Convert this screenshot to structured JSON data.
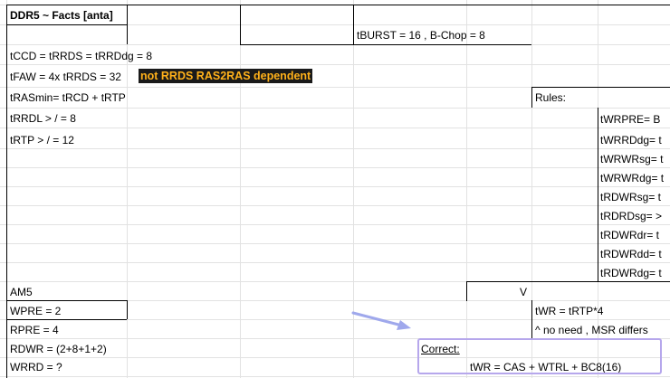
{
  "cells": {
    "title_a": "DDR5 ~ Facts ",
    "title_b": "[anta]",
    "tburst": "tBURST = 16 , B-Chop = 8",
    "tccd": "tCCD = tRRDS = tRRDdg = 8",
    "tfaw": "tFAW = 4x tRRDS = 32",
    "tfaw_note": "not RRDS RAS2RAS dependent",
    "trasmin": "tRASmin= tRCD + tRTP",
    "trrdl": "tRRDL > / = 8",
    "trtp": "tRTP > / = 12",
    "rules": "Rules:",
    "rules_list": [
      "tWRPRE=  B",
      "tWRRDdg= t",
      "tWRWRsg= t",
      "tWRWRdg= t",
      "tRDWRsg= t",
      "tRDRDsg=  >",
      "tRDWRdr=  t",
      "tRDWRdd= t",
      "tRDWRdg= t"
    ],
    "am5": "AM5",
    "v": "V",
    "wpre": "WPRE = 2",
    "twr": "tWR = tRTP*4",
    "rpre": "RPRE = 4",
    "no_need": "^ no need , MSR differs",
    "rdwr": "RDWR = (2+8+1+2)",
    "correct": "Correct:",
    "wrrd": "WRRD = ?",
    "twr_formula": "tWR = CAS + WTRL  + BC8(16)"
  },
  "colors": {
    "grid": "#e2e2e2",
    "highlight_bg": "#1a1a1a",
    "highlight_fg": "#ffb11a",
    "callout_border": "#b6a7ec",
    "arrow": "#9fa8ec"
  }
}
